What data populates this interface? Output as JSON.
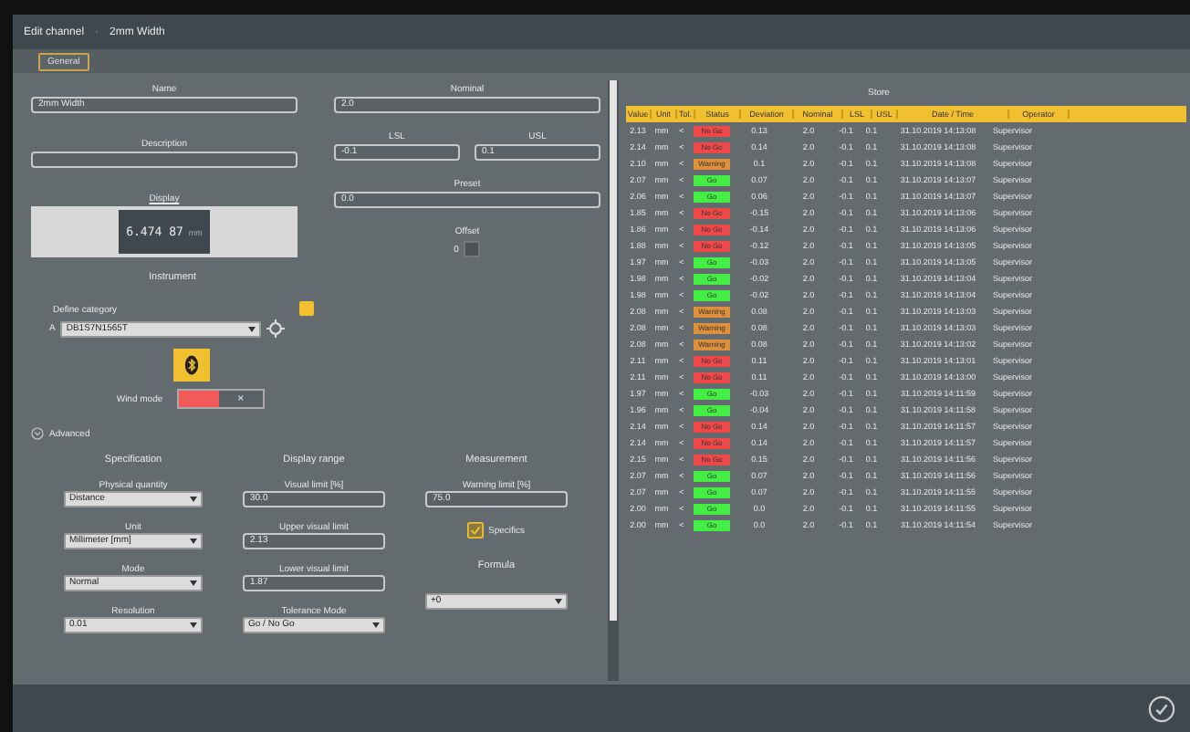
{
  "window": {
    "title": "Edit channel",
    "separator": "·",
    "subtitle": "2mm Width"
  },
  "tabs": [
    {
      "label": "General",
      "selected": true
    }
  ],
  "general": {
    "name": {
      "label": "Name",
      "value": "2mm Width"
    },
    "nominal": {
      "label": "Nominal",
      "value": "2.0"
    },
    "description": {
      "label": "Description"
    },
    "lsl": {
      "label": "LSL",
      "value": "-0.1"
    },
    "usl": {
      "label": "USL",
      "value": "0.1"
    },
    "display": {
      "label": "Display",
      "value": "6.474 87",
      "unit": "mm"
    },
    "preset": {
      "label": "Preset",
      "value": "0.0"
    },
    "offset": {
      "label": "Offset",
      "value": "0"
    }
  },
  "instrument": {
    "heading": "Instrument",
    "category_label": "Define category",
    "prefix": "A",
    "device": "DB1S7N1565T",
    "wind_mode": {
      "label": "Wind mode",
      "on": false,
      "off_glyph": "×"
    }
  },
  "advanced": {
    "label": "Advanced",
    "expanded": true,
    "columns": [
      {
        "heading": "Specification",
        "fields": [
          {
            "kind": "select",
            "label": "Physical quantity",
            "value": "Distance"
          },
          {
            "kind": "select",
            "label": "Unit",
            "value": "Millimeter [mm]"
          },
          {
            "kind": "select",
            "label": "Mode",
            "value": "Normal"
          },
          {
            "kind": "select",
            "label": "Resolution",
            "value": "0.01"
          }
        ]
      },
      {
        "heading": "Display range",
        "fields": [
          {
            "kind": "input",
            "label": "Visual limit [%]",
            "value": "30.0"
          },
          {
            "kind": "input",
            "label": "Upper visual limit",
            "value": "2.13"
          },
          {
            "kind": "input",
            "label": "Lower visual limit",
            "value": "1.87"
          },
          {
            "kind": "select",
            "label": "Tolerance Mode",
            "value": "Go / No Go"
          }
        ]
      },
      {
        "heading": "Measurement",
        "fields": [
          {
            "kind": "input",
            "label": "Warning limit [%]",
            "value": "75.0"
          },
          {
            "kind": "checkbox",
            "label": "Specifics",
            "checked": true
          },
          {
            "kind": "heading",
            "label": "Formula"
          },
          {
            "kind": "select",
            "value": "+0"
          }
        ]
      }
    ]
  },
  "store": {
    "title": "Store",
    "columns": [
      "Value",
      "Unit",
      "Tol.",
      "Status",
      "Deviation",
      "Nominal",
      "LSL",
      "USL",
      "Date / Time",
      "Operator"
    ],
    "rows": [
      {
        "value": "2.13",
        "unit": "mm",
        "tol": "<",
        "status": "No Go",
        "color": "#ee4848",
        "deviation": "0.13",
        "nominal": "2.0",
        "lsl": "-0.1",
        "usl": "0.1",
        "time": "31.10.2019 14:13:08",
        "operator": "Supervisor"
      },
      {
        "value": "2.14",
        "unit": "mm",
        "tol": "<",
        "status": "No Go",
        "color": "#ee4848",
        "deviation": "0.14",
        "nominal": "2.0",
        "lsl": "-0.1",
        "usl": "0.1",
        "time": "31.10.2019 14:13:08",
        "operator": "Supervisor"
      },
      {
        "value": "2.10",
        "unit": "mm",
        "tol": "<",
        "status": "Warning",
        "color": "#e0903a",
        "deviation": "0.1",
        "nominal": "2.0",
        "lsl": "-0.1",
        "usl": "0.1",
        "time": "31.10.2019 14:13:08",
        "operator": "Supervisor"
      },
      {
        "value": "2.07",
        "unit": "mm",
        "tol": "<",
        "status": "Go",
        "color": "#44ee44",
        "deviation": "0.07",
        "nominal": "2.0",
        "lsl": "-0.1",
        "usl": "0.1",
        "time": "31.10.2019 14:13:07",
        "operator": "Supervisor"
      },
      {
        "value": "2.06",
        "unit": "mm",
        "tol": "<",
        "status": "Go",
        "color": "#44ee44",
        "deviation": "0.06",
        "nominal": "2.0",
        "lsl": "-0.1",
        "usl": "0.1",
        "time": "31.10.2019 14:13:07",
        "operator": "Supervisor"
      },
      {
        "value": "1.85",
        "unit": "mm",
        "tol": "<",
        "status": "No Go",
        "color": "#ee4848",
        "deviation": "-0.15",
        "nominal": "2.0",
        "lsl": "-0.1",
        "usl": "0.1",
        "time": "31.10.2019 14:13:06",
        "operator": "Supervisor"
      },
      {
        "value": "1.86",
        "unit": "mm",
        "tol": "<",
        "status": "No Go",
        "color": "#ee4848",
        "deviation": "-0.14",
        "nominal": "2.0",
        "lsl": "-0.1",
        "usl": "0.1",
        "time": "31.10.2019 14:13:06",
        "operator": "Supervisor"
      },
      {
        "value": "1.88",
        "unit": "mm",
        "tol": "<",
        "status": "No Go",
        "color": "#ee4848",
        "deviation": "-0.12",
        "nominal": "2.0",
        "lsl": "-0.1",
        "usl": "0.1",
        "time": "31.10.2019 14:13:05",
        "operator": "Supervisor"
      },
      {
        "value": "1.97",
        "unit": "mm",
        "tol": "<",
        "status": "Go",
        "color": "#44ee44",
        "deviation": "-0.03",
        "nominal": "2.0",
        "lsl": "-0.1",
        "usl": "0.1",
        "time": "31.10.2019 14:13:05",
        "operator": "Supervisor"
      },
      {
        "value": "1.98",
        "unit": "mm",
        "tol": "<",
        "status": "Go",
        "color": "#44ee44",
        "deviation": "-0.02",
        "nominal": "2.0",
        "lsl": "-0.1",
        "usl": "0.1",
        "time": "31.10.2019 14:13:04",
        "operator": "Supervisor"
      },
      {
        "value": "1.98",
        "unit": "mm",
        "tol": "<",
        "status": "Go",
        "color": "#44ee44",
        "deviation": "-0.02",
        "nominal": "2.0",
        "lsl": "-0.1",
        "usl": "0.1",
        "time": "31.10.2019 14:13:04",
        "operator": "Supervisor"
      },
      {
        "value": "2.08",
        "unit": "mm",
        "tol": "<",
        "status": "Warning",
        "color": "#e0903a",
        "deviation": "0.08",
        "nominal": "2.0",
        "lsl": "-0.1",
        "usl": "0.1",
        "time": "31.10.2019 14:13:03",
        "operator": "Supervisor"
      },
      {
        "value": "2.08",
        "unit": "mm",
        "tol": "<",
        "status": "Warning",
        "color": "#e0903a",
        "deviation": "0.08",
        "nominal": "2.0",
        "lsl": "-0.1",
        "usl": "0.1",
        "time": "31.10.2019 14:13:03",
        "operator": "Supervisor"
      },
      {
        "value": "2.08",
        "unit": "mm",
        "tol": "<",
        "status": "Warning",
        "color": "#e0903a",
        "deviation": "0.08",
        "nominal": "2.0",
        "lsl": "-0.1",
        "usl": "0.1",
        "time": "31.10.2019 14:13:02",
        "operator": "Supervisor"
      },
      {
        "value": "2.11",
        "unit": "mm",
        "tol": "<",
        "status": "No Go",
        "color": "#ee4848",
        "deviation": "0.11",
        "nominal": "2.0",
        "lsl": "-0.1",
        "usl": "0.1",
        "time": "31.10.2019 14:13:01",
        "operator": "Supervisor"
      },
      {
        "value": "2.11",
        "unit": "mm",
        "tol": "<",
        "status": "No Go",
        "color": "#ee4848",
        "deviation": "0.11",
        "nominal": "2.0",
        "lsl": "-0.1",
        "usl": "0.1",
        "time": "31.10.2019 14:13:00",
        "operator": "Supervisor"
      },
      {
        "value": "1.97",
        "unit": "mm",
        "tol": "<",
        "status": "Go",
        "color": "#44ee44",
        "deviation": "-0.03",
        "nominal": "2.0",
        "lsl": "-0.1",
        "usl": "0.1",
        "time": "31.10.2019 14:11:59",
        "operator": "Supervisor"
      },
      {
        "value": "1.96",
        "unit": "mm",
        "tol": "<",
        "status": "Go",
        "color": "#44ee44",
        "deviation": "-0.04",
        "nominal": "2.0",
        "lsl": "-0.1",
        "usl": "0.1",
        "time": "31.10.2019 14:11:58",
        "operator": "Supervisor"
      },
      {
        "value": "2.14",
        "unit": "mm",
        "tol": "<",
        "status": "No Go",
        "color": "#ee4848",
        "deviation": "0.14",
        "nominal": "2.0",
        "lsl": "-0.1",
        "usl": "0.1",
        "time": "31.10.2019 14:11:57",
        "operator": "Supervisor"
      },
      {
        "value": "2.14",
        "unit": "mm",
        "tol": "<",
        "status": "No Go",
        "color": "#ee4848",
        "deviation": "0.14",
        "nominal": "2.0",
        "lsl": "-0.1",
        "usl": "0.1",
        "time": "31.10.2019 14:11:57",
        "operator": "Supervisor"
      },
      {
        "value": "2.15",
        "unit": "mm",
        "tol": "<",
        "status": "No Go",
        "color": "#ee4848",
        "deviation": "0.15",
        "nominal": "2.0",
        "lsl": "-0.1",
        "usl": "0.1",
        "time": "31.10.2019 14:11:56",
        "operator": "Supervisor"
      },
      {
        "value": "2.07",
        "unit": "mm",
        "tol": "<",
        "status": "Go",
        "color": "#44ee44",
        "deviation": "0.07",
        "nominal": "2.0",
        "lsl": "-0.1",
        "usl": "0.1",
        "time": "31.10.2019 14:11:56",
        "operator": "Supervisor"
      },
      {
        "value": "2.07",
        "unit": "mm",
        "tol": "<",
        "status": "Go",
        "color": "#44ee44",
        "deviation": "0.07",
        "nominal": "2.0",
        "lsl": "-0.1",
        "usl": "0.1",
        "time": "31.10.2019 14:11:55",
        "operator": "Supervisor"
      },
      {
        "value": "2.00",
        "unit": "mm",
        "tol": "<",
        "status": "Go",
        "color": "#44ee44",
        "deviation": "0.0",
        "nominal": "2.0",
        "lsl": "-0.1",
        "usl": "0.1",
        "time": "31.10.2019 14:11:55",
        "operator": "Supervisor"
      },
      {
        "value": "2.00",
        "unit": "mm",
        "tol": "<",
        "status": "Go",
        "color": "#44ee44",
        "deviation": "0.0",
        "nominal": "2.0",
        "lsl": "-0.1",
        "usl": "0.1",
        "time": "31.10.2019 14:11:54",
        "operator": "Supervisor"
      }
    ]
  }
}
